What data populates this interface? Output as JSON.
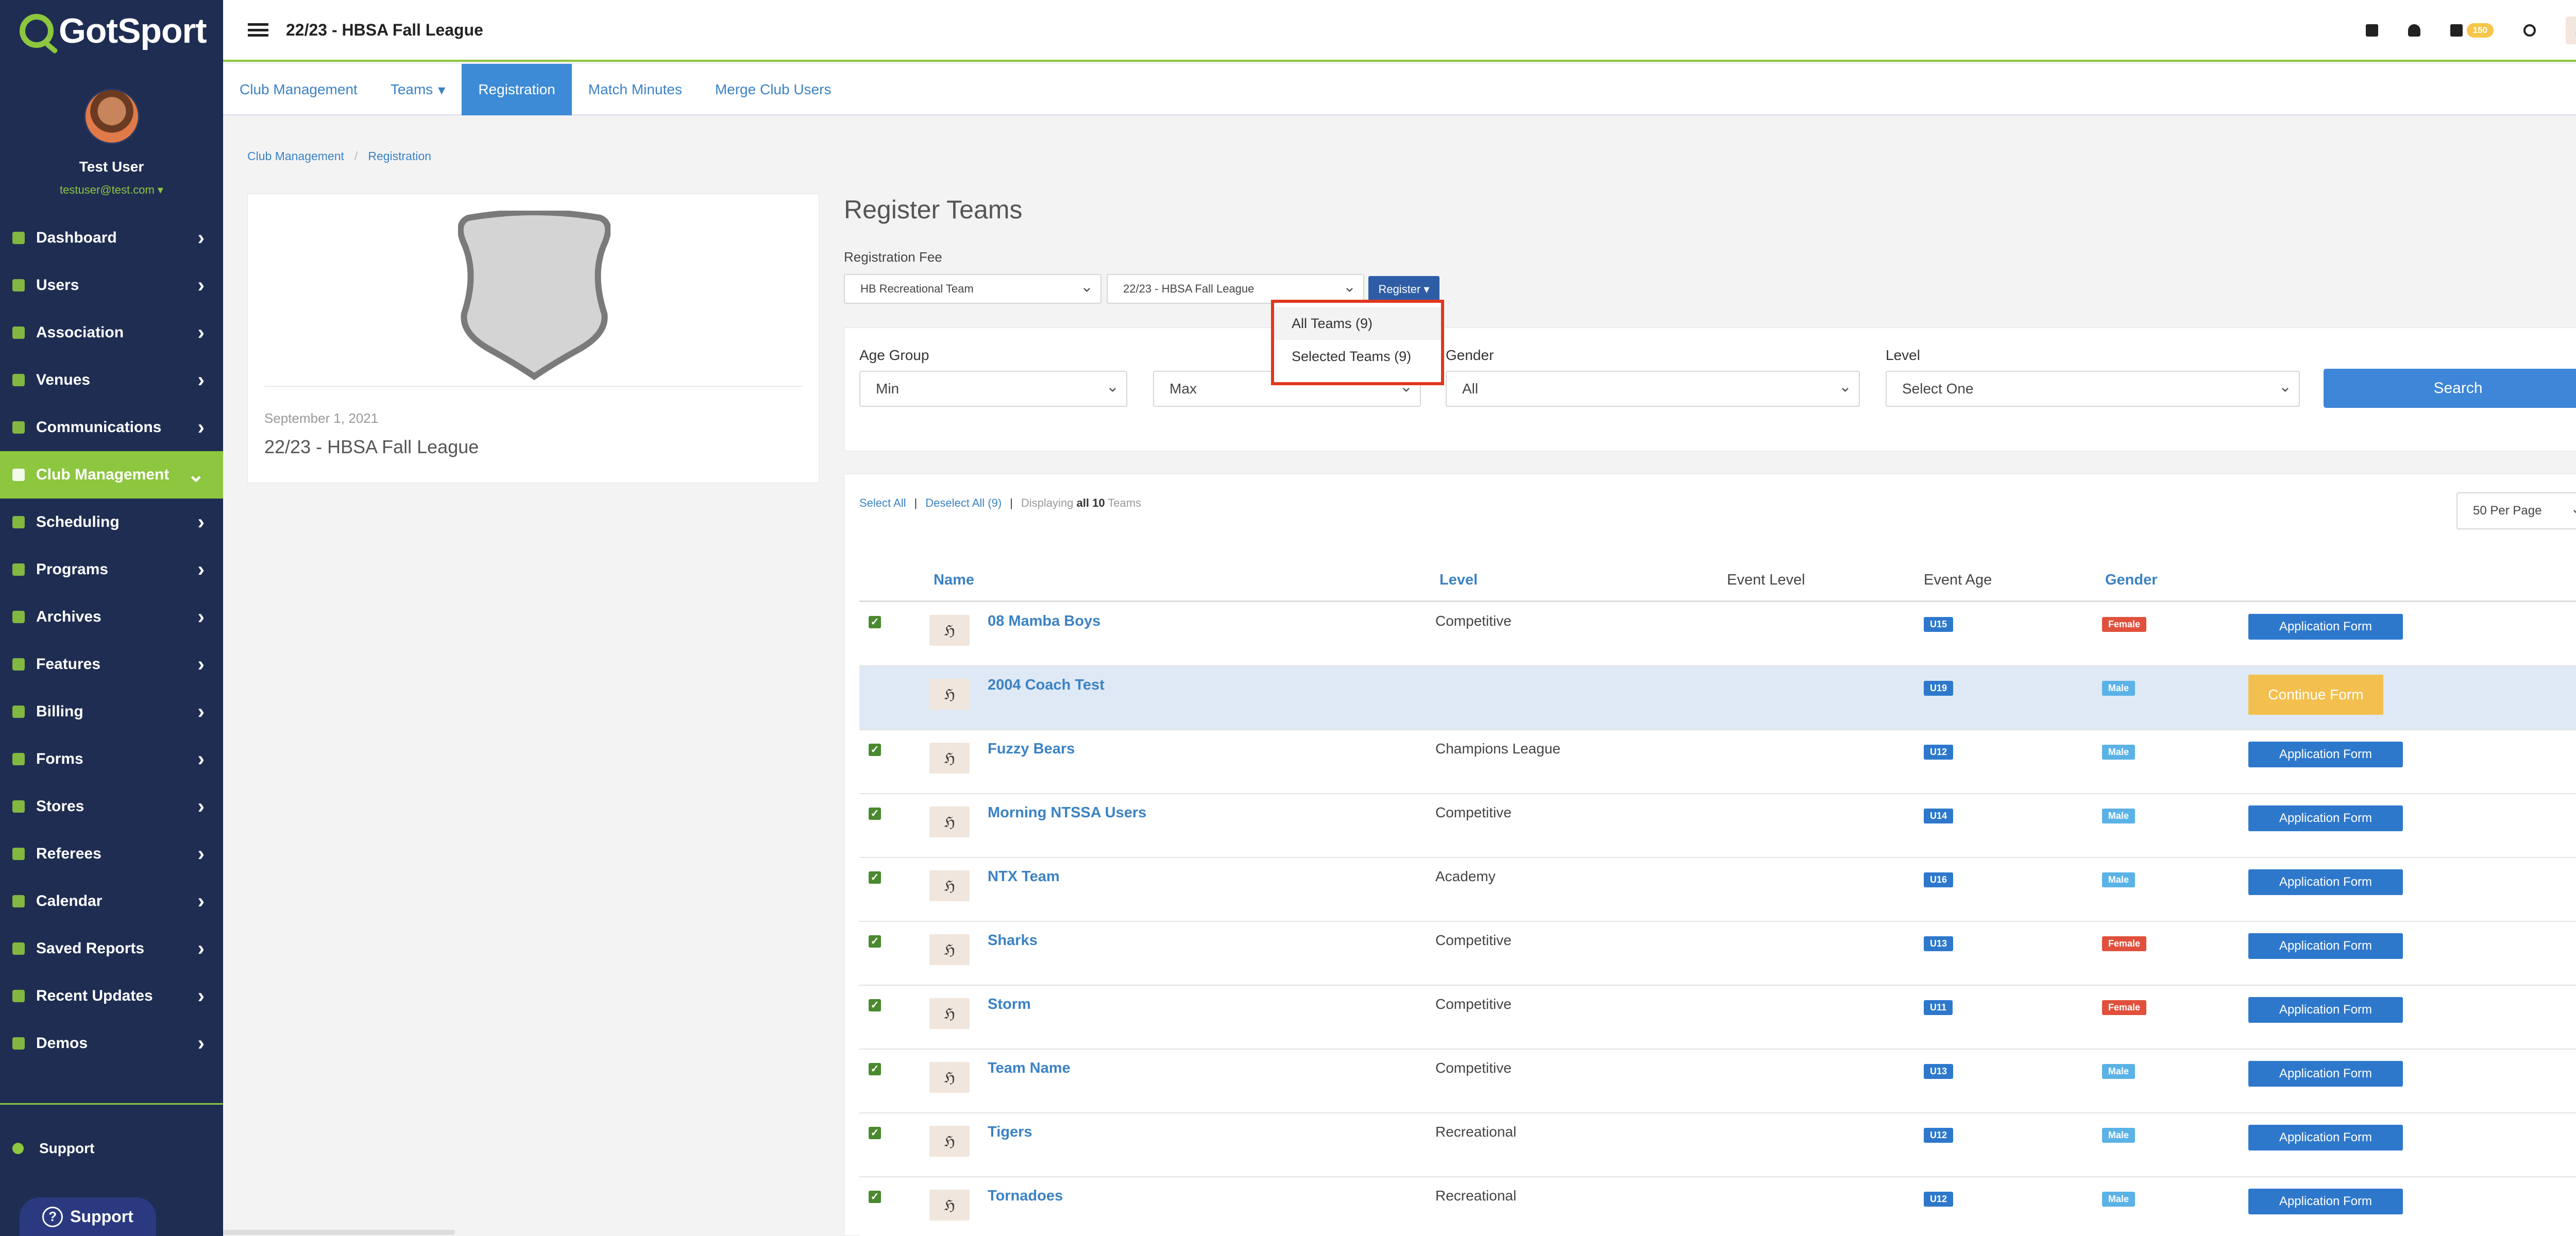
{
  "app": {
    "logo": "GotSport",
    "title": "22/23 - HBSA Fall League"
  },
  "topbar": {
    "mail_count": "150"
  },
  "profile": {
    "name": "Test User",
    "email": "testuser@test.com"
  },
  "sidebar": {
    "items": [
      {
        "label": "Dashboard"
      },
      {
        "label": "Users"
      },
      {
        "label": "Association"
      },
      {
        "label": "Venues"
      },
      {
        "label": "Communications"
      },
      {
        "label": "Club Management"
      },
      {
        "label": "Scheduling"
      },
      {
        "label": "Programs"
      },
      {
        "label": "Archives"
      },
      {
        "label": "Features"
      },
      {
        "label": "Billing"
      },
      {
        "label": "Forms"
      },
      {
        "label": "Stores"
      },
      {
        "label": "Referees"
      },
      {
        "label": "Calendar"
      },
      {
        "label": "Saved Reports"
      },
      {
        "label": "Recent Updates"
      },
      {
        "label": "Demos"
      }
    ],
    "active_item": "Club Management",
    "support_label": "Support",
    "support_button": "Support"
  },
  "tabs": [
    {
      "label": "Club Management"
    },
    {
      "label": "Teams"
    },
    {
      "label": "Registration"
    },
    {
      "label": "Match Minutes"
    },
    {
      "label": "Merge Club Users"
    }
  ],
  "active_tab": "Registration",
  "breadcrumb": [
    "Club Management",
    "Registration"
  ],
  "event": {
    "date": "September 1, 2021",
    "name": "22/23 - HBSA Fall League"
  },
  "register": {
    "title": "Register Teams",
    "fee_label": "Registration Fee",
    "fee_select": "HB Recreational Team",
    "event_select": "22/23 - HBSA Fall League",
    "button": "Register",
    "dropdown": [
      "All Teams (9)",
      "Selected Teams (9)"
    ]
  },
  "filters": {
    "age_group_label": "Age Group",
    "min": "Min",
    "max": "Max",
    "gender_label": "Gender",
    "gender": "All",
    "level_label": "Level",
    "level": "Select One",
    "search": "Search"
  },
  "list": {
    "select_all": "Select All",
    "deselect_all": "Deselect All (9)",
    "displaying_prefix": "Displaying",
    "displaying_all": "all 10",
    "displaying_suffix": "Teams",
    "per_page": "50 Per Page",
    "columns": {
      "name": "Name",
      "level": "Level",
      "event_level": "Event Level",
      "event_age": "Event Age",
      "gender": "Gender"
    },
    "rows": [
      {
        "name": "08 Mamba Boys",
        "level": "Competitive",
        "age": "U15",
        "gender": "Female",
        "action": "Application Form",
        "checked": true
      },
      {
        "name": "2004 Coach Test",
        "level": "",
        "age": "U19",
        "gender": "Male",
        "action": "Continue Form",
        "checked": false
      },
      {
        "name": "Fuzzy Bears",
        "level": "Champions League",
        "age": "U12",
        "gender": "Male",
        "action": "Application Form",
        "checked": true
      },
      {
        "name": "Morning NTSSA Users",
        "level": "Competitive",
        "age": "U14",
        "gender": "Male",
        "action": "Application Form",
        "checked": true
      },
      {
        "name": "NTX Team",
        "level": "Academy",
        "age": "U16",
        "gender": "Male",
        "action": "Application Form",
        "checked": true
      },
      {
        "name": "Sharks",
        "level": "Competitive",
        "age": "U13",
        "gender": "Female",
        "action": "Application Form",
        "checked": true
      },
      {
        "name": "Storm",
        "level": "Competitive",
        "age": "U11",
        "gender": "Female",
        "action": "Application Form",
        "checked": true
      },
      {
        "name": "Team Name",
        "level": "Competitive",
        "age": "U13",
        "gender": "Male",
        "action": "Application Form",
        "checked": true
      },
      {
        "name": "Tigers",
        "level": "Recreational",
        "age": "U12",
        "gender": "Male",
        "action": "Application Form",
        "checked": true
      },
      {
        "name": "Tornadoes",
        "level": "Recreational",
        "age": "U12",
        "gender": "Male",
        "action": "Application Form",
        "checked": true
      }
    ]
  },
  "colors": {
    "sidebar": "#1f2d52",
    "accent": "#8dc63f",
    "primary": "#3d86d8",
    "highlight_box": "#e0371f"
  }
}
